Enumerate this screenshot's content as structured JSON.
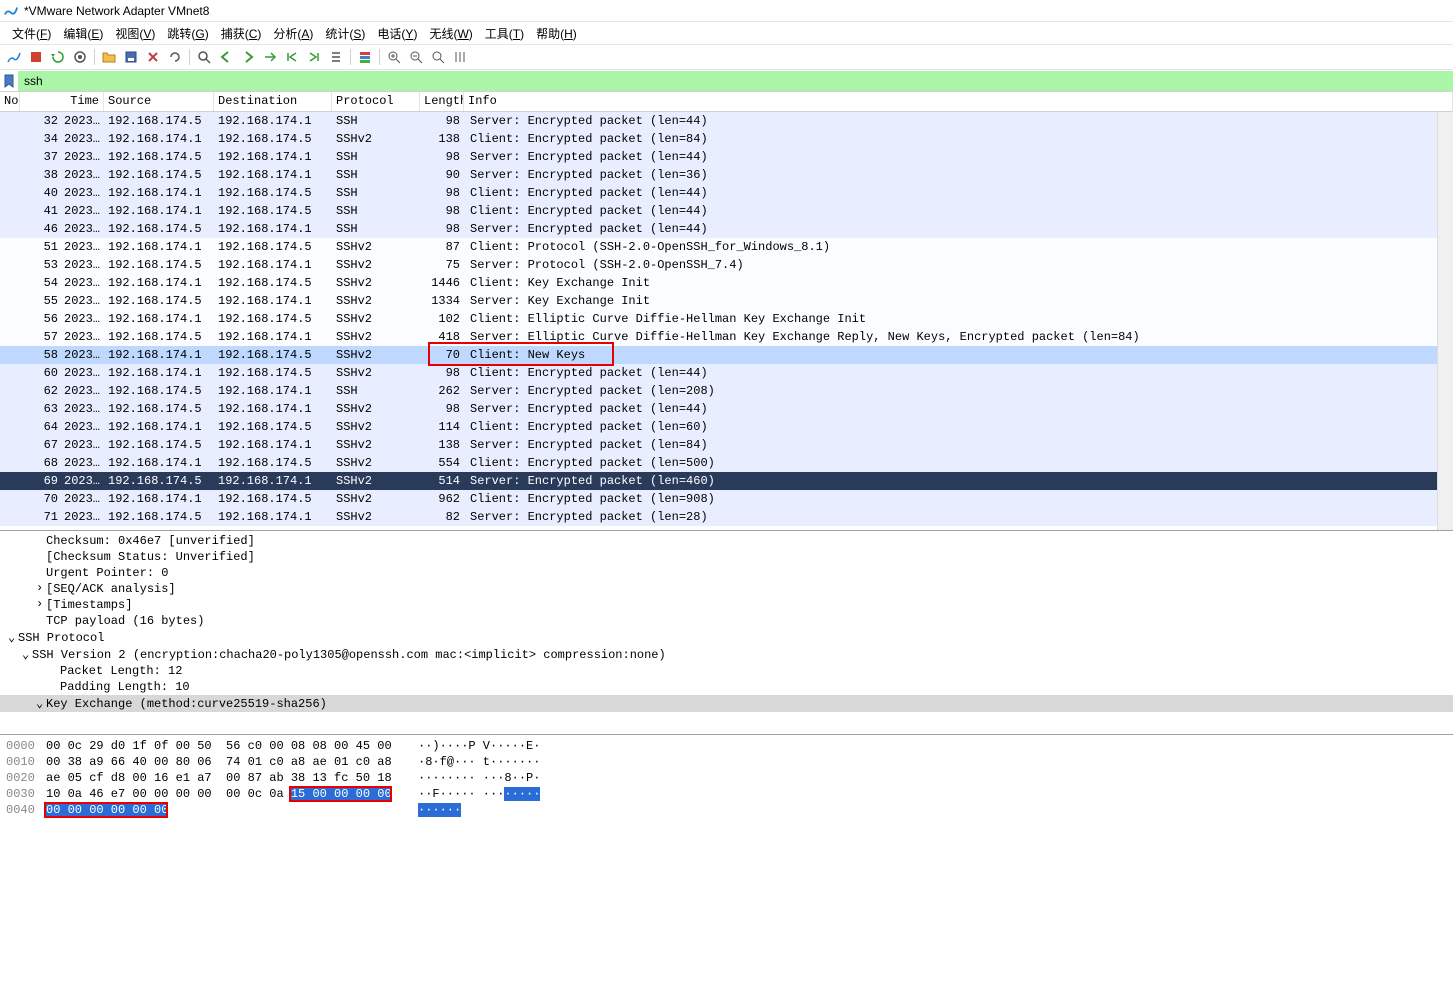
{
  "window": {
    "title": "*VMware Network Adapter VMnet8"
  },
  "menu": {
    "items": [
      {
        "label": "文件",
        "accel": "F"
      },
      {
        "label": "编辑",
        "accel": "E"
      },
      {
        "label": "视图",
        "accel": "V"
      },
      {
        "label": "跳转",
        "accel": "G"
      },
      {
        "label": "捕获",
        "accel": "C"
      },
      {
        "label": "分析",
        "accel": "A"
      },
      {
        "label": "统计",
        "accel": "S"
      },
      {
        "label": "电话",
        "accel": "Y"
      },
      {
        "label": "无线",
        "accel": "W"
      },
      {
        "label": "工具",
        "accel": "T"
      },
      {
        "label": "帮助",
        "accel": "H"
      }
    ]
  },
  "filter": {
    "value": "ssh"
  },
  "columns": {
    "no": "No.",
    "time": "Time",
    "source": "Source",
    "destination": "Destination",
    "protocol": "Protocol",
    "length": "Length",
    "info": "Info"
  },
  "packets": [
    {
      "no": 32,
      "time": "2023…",
      "src": "192.168.174.5",
      "dst": "192.168.174.1",
      "proto": "SSH",
      "len": 98,
      "info": "Server: Encrypted packet (len=44)",
      "bg": 0
    },
    {
      "no": 34,
      "time": "2023…",
      "src": "192.168.174.1",
      "dst": "192.168.174.5",
      "proto": "SSHv2",
      "len": 138,
      "info": "Client: Encrypted packet (len=84)",
      "bg": 0
    },
    {
      "no": 37,
      "time": "2023…",
      "src": "192.168.174.5",
      "dst": "192.168.174.1",
      "proto": "SSH",
      "len": 98,
      "info": "Server: Encrypted packet (len=44)",
      "bg": 0
    },
    {
      "no": 38,
      "time": "2023…",
      "src": "192.168.174.5",
      "dst": "192.168.174.1",
      "proto": "SSH",
      "len": 90,
      "info": "Server: Encrypted packet (len=36)",
      "bg": 0
    },
    {
      "no": 40,
      "time": "2023…",
      "src": "192.168.174.1",
      "dst": "192.168.174.5",
      "proto": "SSH",
      "len": 98,
      "info": "Client: Encrypted packet (len=44)",
      "bg": 0
    },
    {
      "no": 41,
      "time": "2023…",
      "src": "192.168.174.1",
      "dst": "192.168.174.5",
      "proto": "SSH",
      "len": 98,
      "info": "Client: Encrypted packet (len=44)",
      "bg": 0
    },
    {
      "no": 46,
      "time": "2023…",
      "src": "192.168.174.5",
      "dst": "192.168.174.1",
      "proto": "SSH",
      "len": 98,
      "info": "Server: Encrypted packet (len=44)",
      "bg": 0
    },
    {
      "no": 51,
      "time": "2023…",
      "src": "192.168.174.1",
      "dst": "192.168.174.5",
      "proto": "SSHv2",
      "len": 87,
      "info": "Client: Protocol (SSH-2.0-OpenSSH_for_Windows_8.1)",
      "bg": 1
    },
    {
      "no": 53,
      "time": "2023…",
      "src": "192.168.174.5",
      "dst": "192.168.174.1",
      "proto": "SSHv2",
      "len": 75,
      "info": "Server: Protocol (SSH-2.0-OpenSSH_7.4)",
      "bg": 1
    },
    {
      "no": 54,
      "time": "2023…",
      "src": "192.168.174.1",
      "dst": "192.168.174.5",
      "proto": "SSHv2",
      "len": 1446,
      "info": "Client: Key Exchange Init",
      "bg": 1
    },
    {
      "no": 55,
      "time": "2023…",
      "src": "192.168.174.5",
      "dst": "192.168.174.1",
      "proto": "SSHv2",
      "len": 1334,
      "info": "Server: Key Exchange Init",
      "bg": 1
    },
    {
      "no": 56,
      "time": "2023…",
      "src": "192.168.174.1",
      "dst": "192.168.174.5",
      "proto": "SSHv2",
      "len": 102,
      "info": "Client: Elliptic Curve Diffie-Hellman Key Exchange Init",
      "bg": 1
    },
    {
      "no": 57,
      "time": "2023…",
      "src": "192.168.174.5",
      "dst": "192.168.174.1",
      "proto": "SSHv2",
      "len": 418,
      "info": "Server: Elliptic Curve Diffie-Hellman Key Exchange Reply, New Keys, Encrypted packet (len=84)",
      "bg": 1
    },
    {
      "no": 58,
      "time": "2023…",
      "src": "192.168.174.1",
      "dst": "192.168.174.5",
      "proto": "SSHv2",
      "len": 70,
      "info": "Client: New Keys",
      "bg": 1,
      "hl": true,
      "anno": true
    },
    {
      "no": 60,
      "time": "2023…",
      "src": "192.168.174.1",
      "dst": "192.168.174.5",
      "proto": "SSHv2",
      "len": 98,
      "info": "Client: Encrypted packet (len=44)",
      "bg": 0
    },
    {
      "no": 62,
      "time": "2023…",
      "src": "192.168.174.5",
      "dst": "192.168.174.1",
      "proto": "SSH",
      "len": 262,
      "info": "Server: Encrypted packet (len=208)",
      "bg": 0
    },
    {
      "no": 63,
      "time": "2023…",
      "src": "192.168.174.5",
      "dst": "192.168.174.1",
      "proto": "SSHv2",
      "len": 98,
      "info": "Server: Encrypted packet (len=44)",
      "bg": 0
    },
    {
      "no": 64,
      "time": "2023…",
      "src": "192.168.174.1",
      "dst": "192.168.174.5",
      "proto": "SSHv2",
      "len": 114,
      "info": "Client: Encrypted packet (len=60)",
      "bg": 0
    },
    {
      "no": 67,
      "time": "2023…",
      "src": "192.168.174.5",
      "dst": "192.168.174.1",
      "proto": "SSHv2",
      "len": 138,
      "info": "Server: Encrypted packet (len=84)",
      "bg": 0
    },
    {
      "no": 68,
      "time": "2023…",
      "src": "192.168.174.1",
      "dst": "192.168.174.5",
      "proto": "SSHv2",
      "len": 554,
      "info": "Client: Encrypted packet (len=500)",
      "bg": 0
    },
    {
      "no": 69,
      "time": "2023…",
      "src": "192.168.174.5",
      "dst": "192.168.174.1",
      "proto": "SSHv2",
      "len": 514,
      "info": "Server: Encrypted packet (len=460)",
      "bg": 0,
      "sel": true
    },
    {
      "no": 70,
      "time": "2023…",
      "src": "192.168.174.1",
      "dst": "192.168.174.5",
      "proto": "SSHv2",
      "len": 962,
      "info": "Client: Encrypted packet (len=908)",
      "bg": 0
    },
    {
      "no": 71,
      "time": "2023…",
      "src": "192.168.174.5",
      "dst": "192.168.174.1",
      "proto": "SSHv2",
      "len": 82,
      "info": "Server: Encrypted packet (len=28)",
      "bg": 0
    }
  ],
  "details": {
    "lines": [
      {
        "indent": 2,
        "text": "Checksum: 0x46e7 [unverified]"
      },
      {
        "indent": 2,
        "text": "[Checksum Status: Unverified]"
      },
      {
        "indent": 2,
        "text": "Urgent Pointer: 0"
      },
      {
        "indent": 2,
        "text": "[SEQ/ACK analysis]",
        "exp": true
      },
      {
        "indent": 2,
        "text": "[Timestamps]",
        "exp": true
      },
      {
        "indent": 2,
        "text": "TCP payload (16 bytes)"
      },
      {
        "indent": 0,
        "text": "SSH Protocol",
        "col": true
      },
      {
        "indent": 1,
        "text": "SSH Version 2 (encryption:chacha20-poly1305@openssh.com mac:<implicit> compression:none)",
        "col": true
      },
      {
        "indent": 3,
        "text": "Packet Length: 12"
      },
      {
        "indent": 3,
        "text": "Padding Length: 10"
      },
      {
        "indent": 2,
        "text": "Key Exchange (method:curve25519-sha256)",
        "col": true,
        "hl": true
      }
    ]
  },
  "hex": {
    "rows": [
      {
        "off": "0000",
        "bytes": "00 0c 29 d0 1f 0f 00 50  56 c0 00 08 08 00 45 00",
        "ascii": "··)····P V·····E·"
      },
      {
        "off": "0010",
        "bytes": "00 38 a9 66 40 00 80 06  74 01 c0 a8 ae 01 c0 a8",
        "ascii": "·8·f@··· t·······"
      },
      {
        "off": "0020",
        "bytes": "ae 05 cf d8 00 16 e1 a7  00 87 ab 38 13 fc 50 18",
        "ascii": "········ ···8··P·"
      },
      {
        "off": "0030",
        "bytes": "10 0a 46 e7 00 00 00 00  00 0c 0a ",
        "selbytes": "15 00 00 00 00",
        "ascii": "··F····· ···",
        "selascii": "·····"
      },
      {
        "off": "0040",
        "bytes": "",
        "selbytes": "00 00 00 00 00 00",
        "ascii": "",
        "selascii": "······"
      }
    ]
  }
}
